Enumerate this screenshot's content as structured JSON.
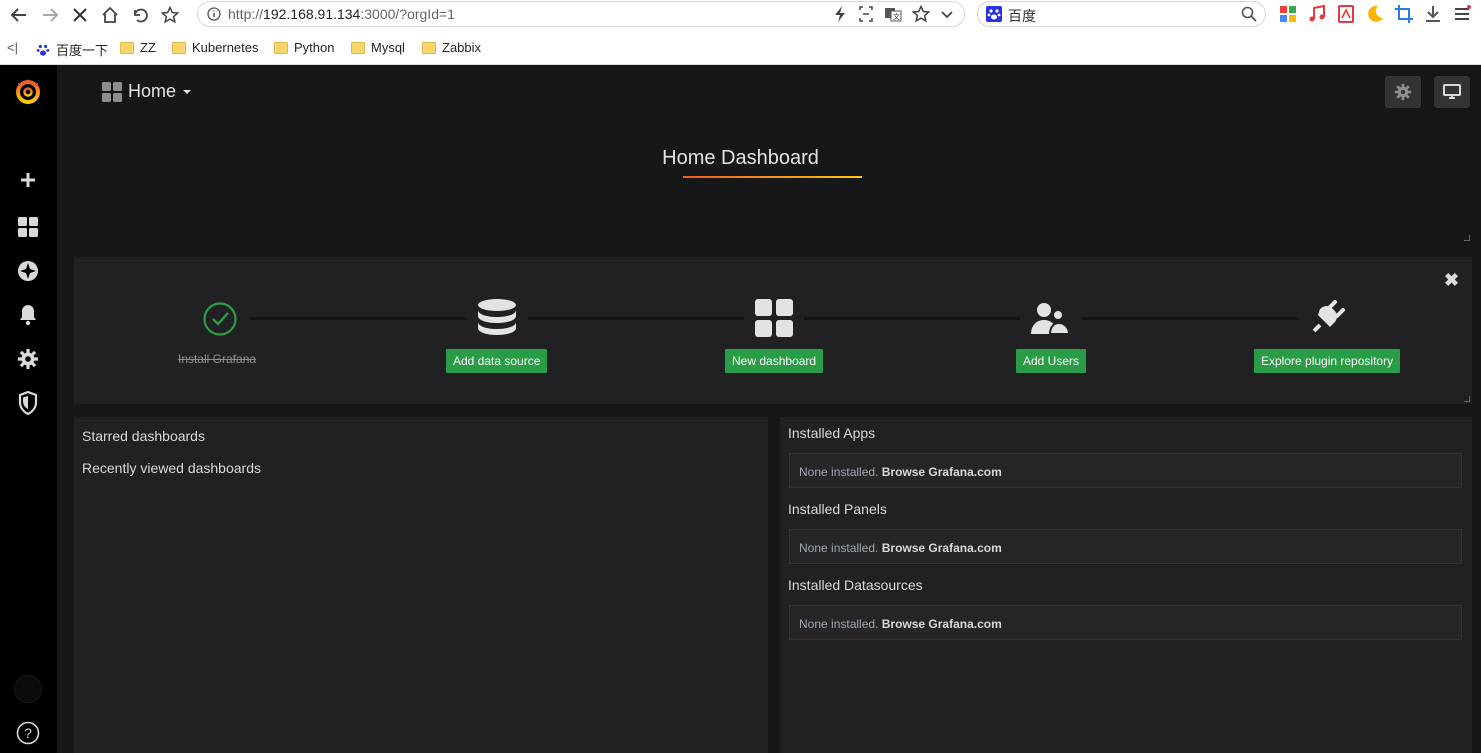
{
  "browser": {
    "url_prefix": "http://",
    "url_host": "192.168.91.134",
    "url_rest": ":3000/?orgId=1",
    "search_label": "百度",
    "bookmarks": [
      {
        "label": "百度一下"
      },
      {
        "label": "ZZ"
      },
      {
        "label": "Kubernetes"
      },
      {
        "label": "Python"
      },
      {
        "label": "Mysql"
      },
      {
        "label": "Zabbix"
      }
    ],
    "bookmarks_collapse": "<|"
  },
  "topbar": {
    "title": "Home"
  },
  "dashboard": {
    "title": "Home Dashboard"
  },
  "getting_started": {
    "close": "✖",
    "steps": [
      {
        "label": "Install Grafana",
        "done": true
      },
      {
        "label": "Add data source"
      },
      {
        "label": "New dashboard"
      },
      {
        "label": "Add Users"
      },
      {
        "label": "Explore plugin repository"
      }
    ]
  },
  "dashlists": {
    "starred": "Starred dashboards",
    "recent": "Recently viewed dashboards"
  },
  "plugins": {
    "sections": [
      {
        "title": "Installed Apps",
        "empty": "None installed.",
        "link": "Browse Grafana.com"
      },
      {
        "title": "Installed Panels",
        "empty": "None installed.",
        "link": "Browse Grafana.com"
      },
      {
        "title": "Installed Datasources",
        "empty": "None installed.",
        "link": "Browse Grafana.com"
      }
    ]
  },
  "help": {
    "label": "?"
  },
  "colors": {
    "accent_green": "#299c46",
    "grafana_orange": "#f05a28",
    "grafana_yellow": "#fbca0a"
  }
}
